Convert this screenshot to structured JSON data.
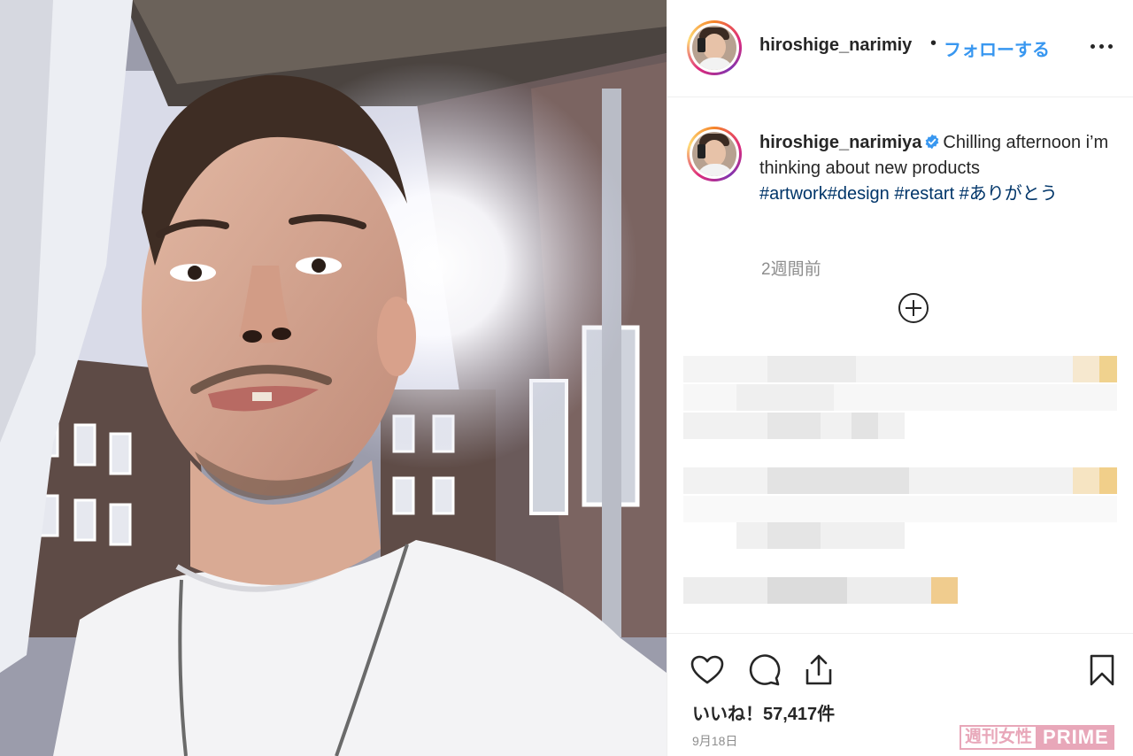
{
  "post": {
    "username_header": "hiroshige_narimiy",
    "separator": "•",
    "follow_label": "フォローする",
    "caption_username": "hiroshige_narimiya",
    "caption_text": "Chilling afternoon i’m thinking about new products ",
    "hashtags": [
      "#artwork",
      "#design",
      " #restart",
      " #ありがとう"
    ],
    "time_ago": "2週間前",
    "likes": "いいね！57,417件",
    "date": "9月18日"
  },
  "icons": {
    "more": "more-options-icon",
    "verified": "verified-badge-icon",
    "add": "plus-circle-icon",
    "like": "heart-icon",
    "comment": "comment-icon",
    "share": "share-icon",
    "save": "bookmark-icon"
  },
  "colors": {
    "follow_blue": "#3897f0",
    "hashtag": "#003569",
    "verified": "#3897f0",
    "watermark_pink": "#e8a7b9"
  },
  "watermark": {
    "jp": "週刊女性",
    "en": "PRIME"
  }
}
